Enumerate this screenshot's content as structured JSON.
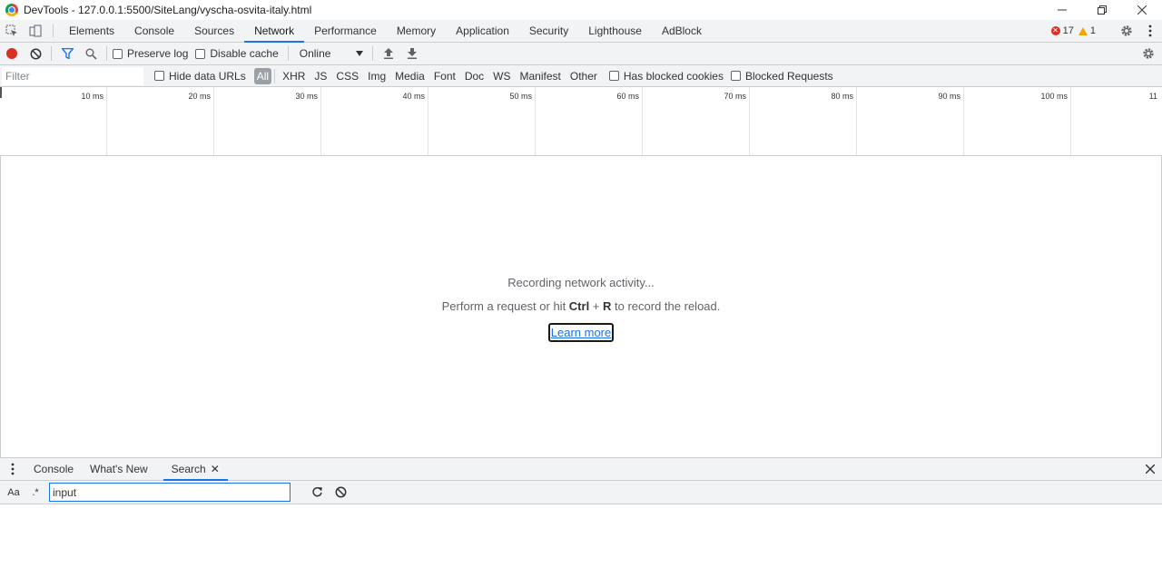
{
  "window": {
    "title": "DevTools - 127.0.0.1:5500/SiteLang/vyscha-osvita-italy.html"
  },
  "main_tabs": [
    {
      "label": "Elements"
    },
    {
      "label": "Console"
    },
    {
      "label": "Sources"
    },
    {
      "label": "Network"
    },
    {
      "label": "Performance"
    },
    {
      "label": "Memory"
    },
    {
      "label": "Application"
    },
    {
      "label": "Security"
    },
    {
      "label": "Lighthouse"
    },
    {
      "label": "AdBlock"
    }
  ],
  "active_main_tab": "Network",
  "status": {
    "errors": "17",
    "warnings": "1"
  },
  "network_toolbar": {
    "preserve_log": "Preserve log",
    "disable_cache": "Disable cache",
    "throttle_value": "Online"
  },
  "filter_bar": {
    "filter_placeholder": "Filter",
    "hide_data_urls": "Hide data URLs",
    "types": [
      "All",
      "XHR",
      "JS",
      "CSS",
      "Img",
      "Media",
      "Font",
      "Doc",
      "WS",
      "Manifest",
      "Other"
    ],
    "has_blocked_cookies": "Has blocked cookies",
    "blocked_requests": "Blocked Requests"
  },
  "timeline": {
    "ticks": [
      "10 ms",
      "20 ms",
      "30 ms",
      "40 ms",
      "50 ms",
      "60 ms",
      "70 ms",
      "80 ms",
      "90 ms",
      "100 ms",
      "11"
    ]
  },
  "empty_state": {
    "line1": "Recording network activity...",
    "line2_prefix": "Perform a request or hit ",
    "line2_key1": "Ctrl",
    "line2_plus": " + ",
    "line2_key2": "R",
    "line2_suffix": " to record the reload.",
    "learn_more": "Learn more"
  },
  "drawer": {
    "tabs": [
      {
        "label": "Console"
      },
      {
        "label": "What's New"
      },
      {
        "label": "Search"
      }
    ],
    "active_tab": "Search",
    "search": {
      "case_toggle": "Aa",
      "regex_toggle": ".*",
      "input_value": "input"
    }
  },
  "colors": {
    "record_red": "#d93025",
    "accent_blue": "#1a73e8",
    "warning": "#f2a600",
    "toolbar_bg": "#f1f3f4"
  }
}
